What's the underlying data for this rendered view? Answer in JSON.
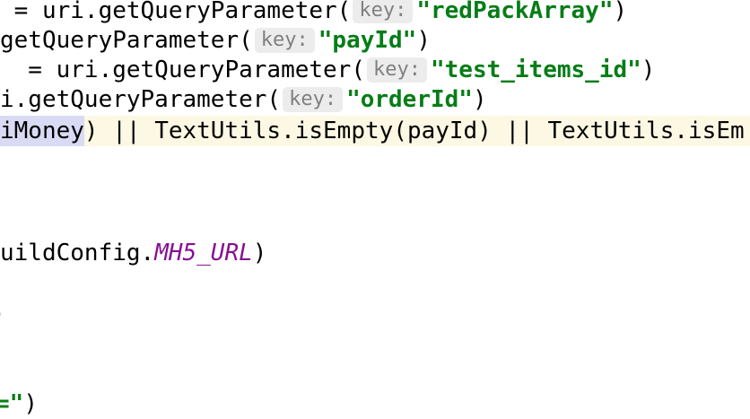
{
  "colors": {
    "string": "#067d17",
    "hint_bg": "#ececec",
    "hint_text": "#808080",
    "constant": "#871094",
    "current_line_bg": "#fdf8e4",
    "identifier_highlight": "#d9daf4"
  },
  "code": {
    "line1": {
      "lead": " = uri.getQueryParameter(",
      "hint": "key:",
      "string": "\"redPackArray\"",
      "tail": ")"
    },
    "line2": {
      "lead": "getQueryParameter(",
      "hint": "key:",
      "string": "\"payId\"",
      "tail": ")"
    },
    "line3": {
      "lead": "  = uri.getQueryParameter(",
      "hint": "key:",
      "string": "\"test_items_id\"",
      "tail": ")"
    },
    "line4": {
      "lead": "i.getQueryParameter(",
      "hint": "key:",
      "string": "\"orderId\"",
      "tail": ")"
    },
    "line5": {
      "highlighted": "iMoney",
      "rest": ") || TextUtils.isEmpty(payId) || TextUtils.isEm"
    },
    "line6": {
      "lead": "uildConfig.",
      "constant": "MH5_URL",
      "tail": ")"
    },
    "line7": {
      "text": ")"
    },
    "line8": {
      "string": "=\"",
      "tail": ")"
    }
  }
}
